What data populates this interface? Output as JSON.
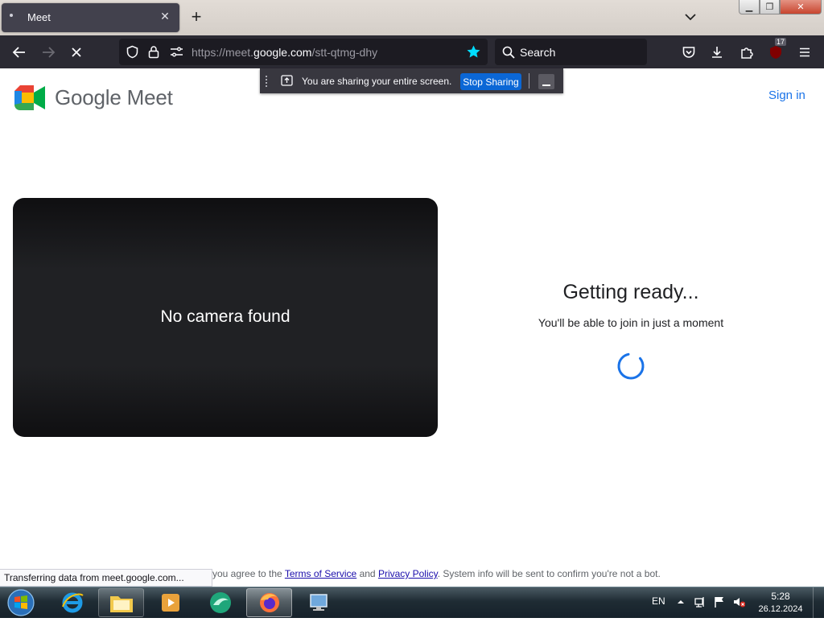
{
  "browser": {
    "tab_title": "Meet",
    "url_scheme": "https://",
    "url_sub": "meet.",
    "url_host": "google.com",
    "url_path": "/stt-qtmg-dhy",
    "search_placeholder": "Search",
    "badge_count": "17",
    "status_text": "Transferring data from meet.google.com..."
  },
  "share_banner": {
    "message": "You are sharing your entire screen.",
    "stop_label": "Stop Sharing"
  },
  "page": {
    "logo_text": "Google Meet",
    "sign_in": "Sign in",
    "preview_message": "No camera found",
    "ready_title": "Getting ready...",
    "ready_subtitle": "You'll be able to join in just a moment",
    "footer_prefix": "you agree to the",
    "terms_link": "Terms of Service",
    "footer_and": "and",
    "privacy_link": "Privacy Policy",
    "footer_suffix": ". System info will be sent to confirm you're not a bot."
  },
  "taskbar": {
    "language": "EN",
    "time": "5:28",
    "date": "26.12.2024"
  },
  "colors": {
    "accent": "#1a73e8",
    "stop_sharing": "#0b67d6",
    "toolbar": "#2b2a33"
  }
}
